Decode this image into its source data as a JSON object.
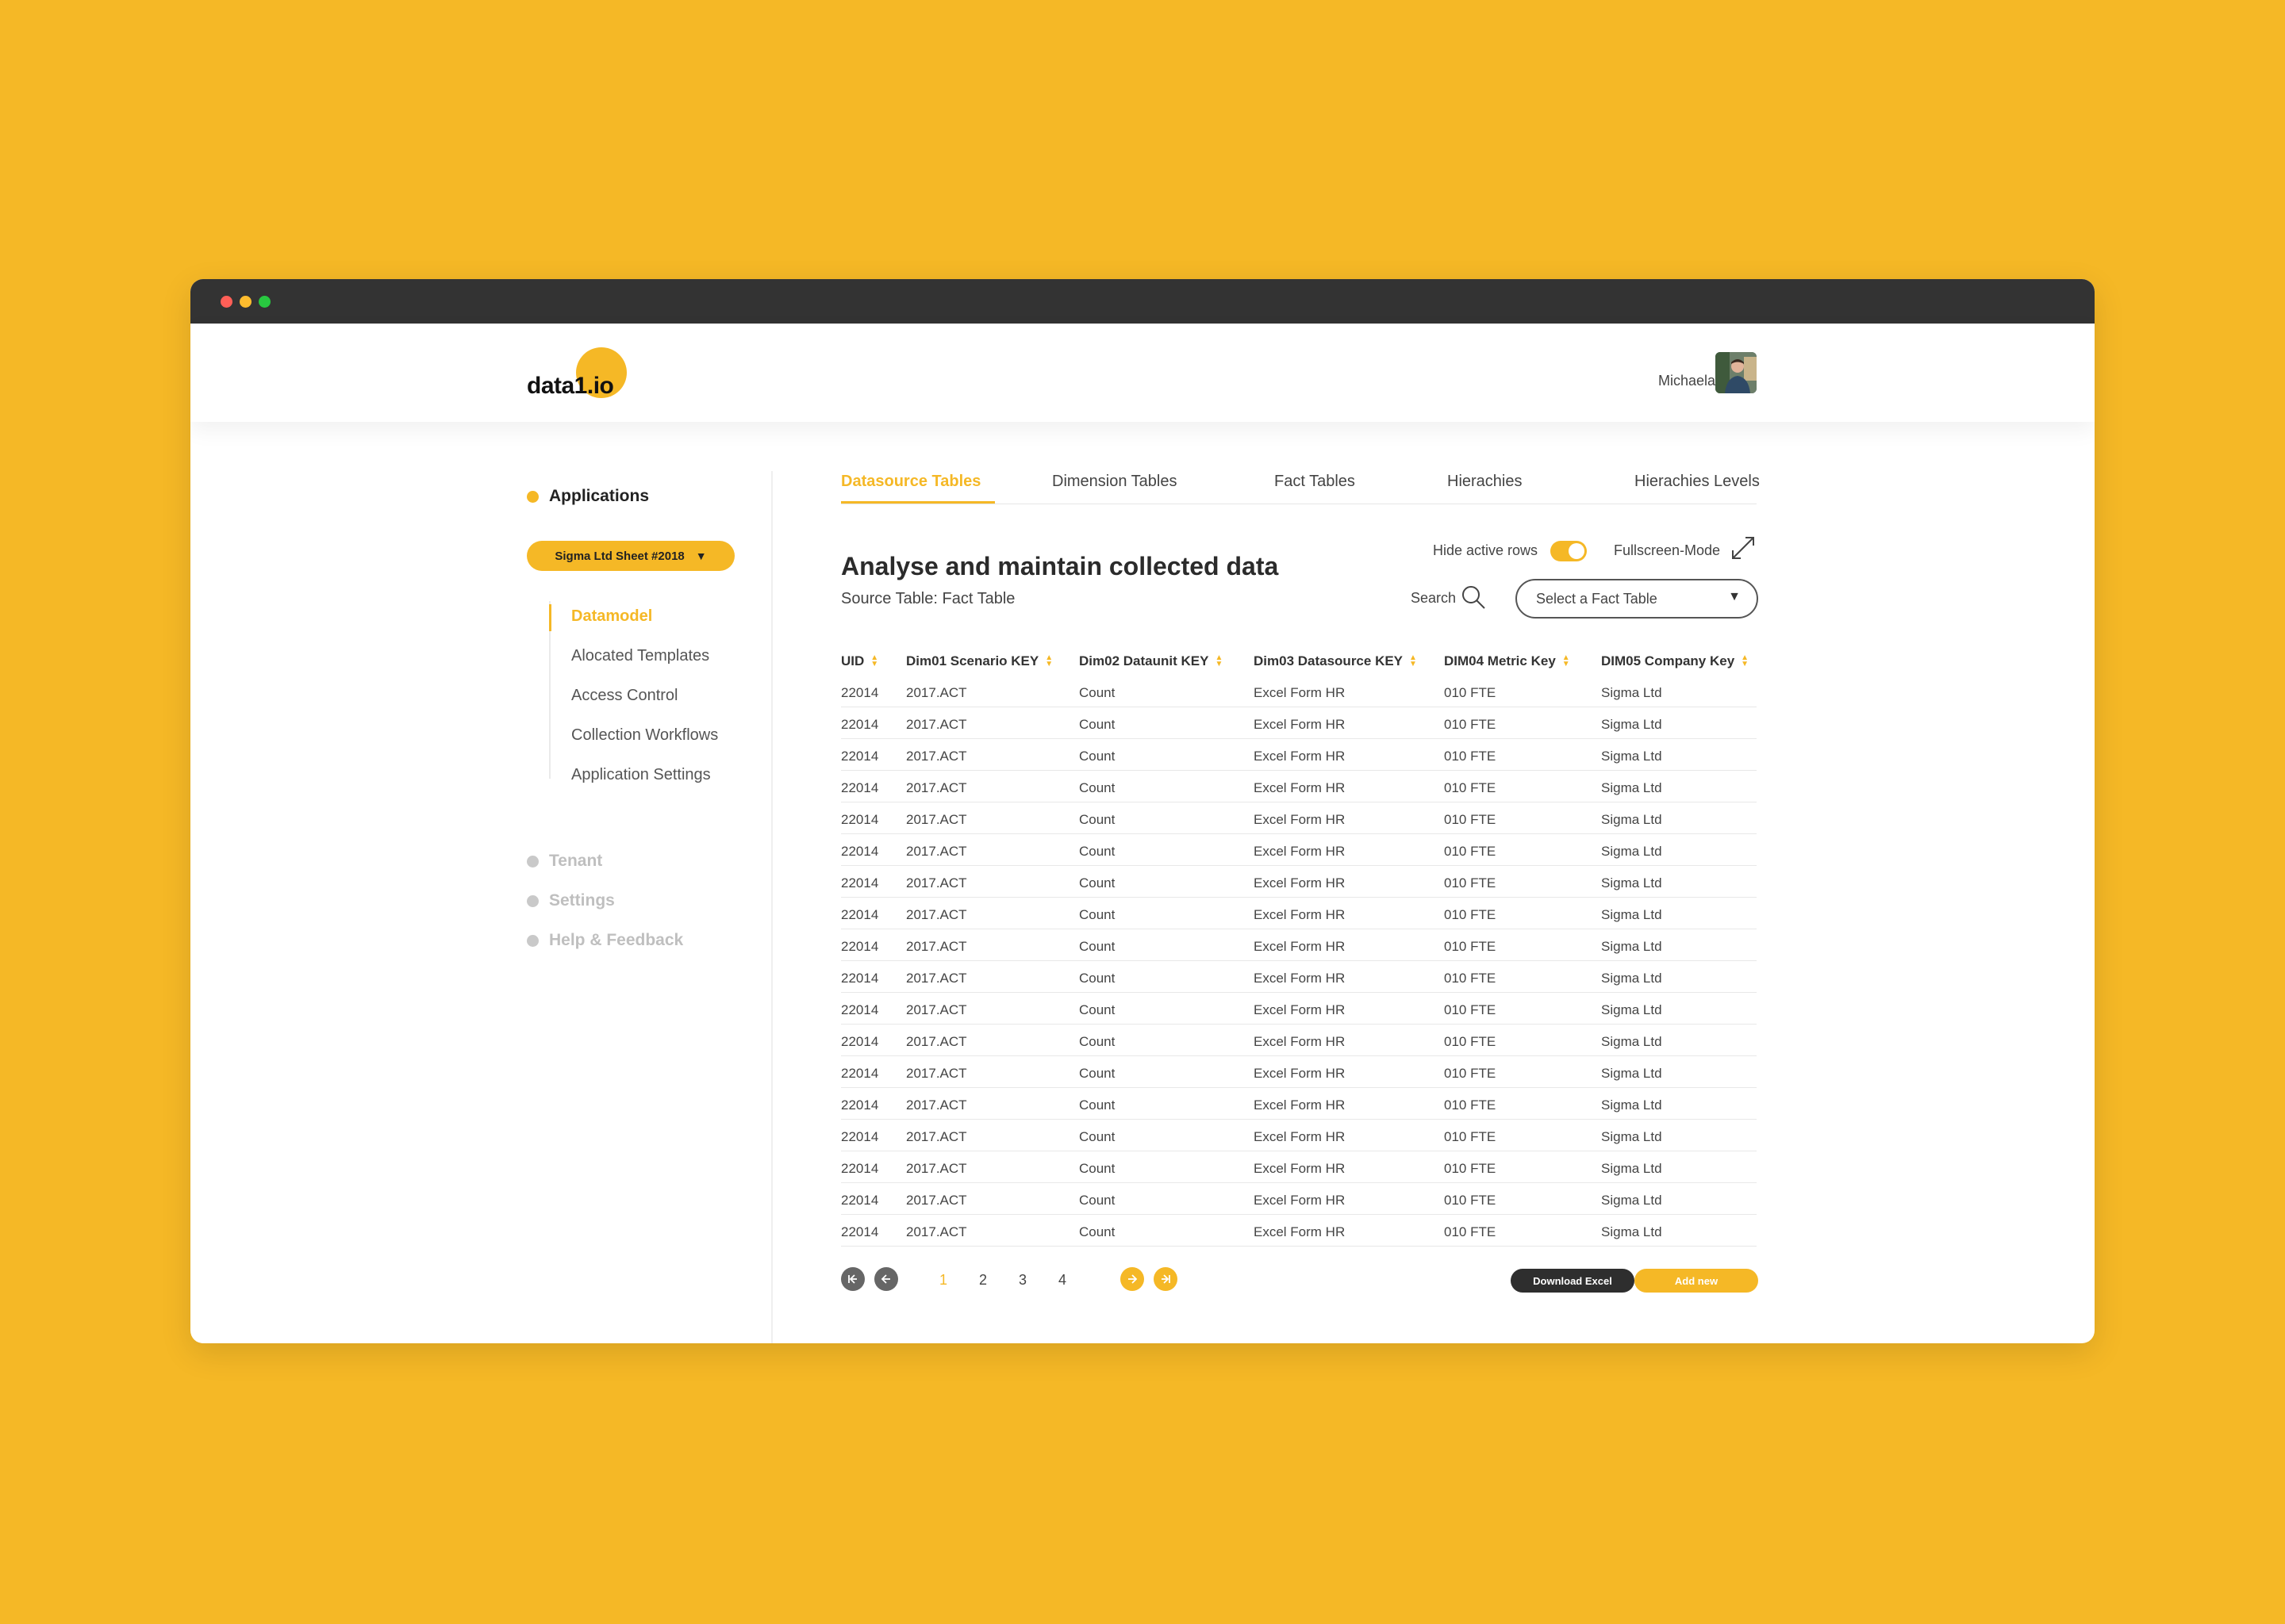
{
  "header": {
    "logo_text": "data1.io",
    "user_name": "Michaela"
  },
  "sidebar": {
    "applications_label": "Applications",
    "app_selector": "Sigma Ltd Sheet #2018",
    "sub_items": [
      {
        "label": "Datamodel",
        "active": true
      },
      {
        "label": "Alocated Templates",
        "active": false
      },
      {
        "label": "Access Control",
        "active": false
      },
      {
        "label": "Collection Workflows",
        "active": false
      },
      {
        "label": "Application Settings",
        "active": false
      }
    ],
    "other_sections": [
      "Tenant",
      "Settings",
      "Help & Feedback"
    ]
  },
  "tabs": [
    {
      "label": "Datasource Tables",
      "active": true
    },
    {
      "label": "Dimension Tables",
      "active": false
    },
    {
      "label": "Fact Tables",
      "active": false
    },
    {
      "label": "Hierachies",
      "active": false
    },
    {
      "label": "Hierachies Levels",
      "active": false
    }
  ],
  "main": {
    "title": "Analyse and maintain collected data",
    "subtitle": "Source Table: Fact Table",
    "hide_rows_label": "Hide active rows",
    "hide_rows_on": true,
    "fullscreen_label": "Fullscreen-Mode",
    "search_label": "Search",
    "fact_select_placeholder": "Select a Fact Table"
  },
  "table": {
    "columns": [
      "UID",
      "Dim01 Scenario KEY",
      "Dim02 Dataunit KEY",
      "Dim03 Datasource KEY",
      "DIM04 Metric Key",
      "DIM05 Company Key"
    ],
    "rows": [
      [
        "22014",
        "2017.ACT",
        "Count",
        "Excel Form HR",
        "010 FTE",
        "Sigma Ltd"
      ],
      [
        "22014",
        "2017.ACT",
        "Count",
        "Excel Form HR",
        "010 FTE",
        "Sigma Ltd"
      ],
      [
        "22014",
        "2017.ACT",
        "Count",
        "Excel Form HR",
        "010 FTE",
        "Sigma Ltd"
      ],
      [
        "22014",
        "2017.ACT",
        "Count",
        "Excel Form HR",
        "010 FTE",
        "Sigma Ltd"
      ],
      [
        "22014",
        "2017.ACT",
        "Count",
        "Excel Form HR",
        "010 FTE",
        "Sigma Ltd"
      ],
      [
        "22014",
        "2017.ACT",
        "Count",
        "Excel Form HR",
        "010 FTE",
        "Sigma Ltd"
      ],
      [
        "22014",
        "2017.ACT",
        "Count",
        "Excel Form HR",
        "010 FTE",
        "Sigma Ltd"
      ],
      [
        "22014",
        "2017.ACT",
        "Count",
        "Excel Form HR",
        "010 FTE",
        "Sigma Ltd"
      ],
      [
        "22014",
        "2017.ACT",
        "Count",
        "Excel Form HR",
        "010 FTE",
        "Sigma Ltd"
      ],
      [
        "22014",
        "2017.ACT",
        "Count",
        "Excel Form HR",
        "010 FTE",
        "Sigma Ltd"
      ],
      [
        "22014",
        "2017.ACT",
        "Count",
        "Excel Form HR",
        "010 FTE",
        "Sigma Ltd"
      ],
      [
        "22014",
        "2017.ACT",
        "Count",
        "Excel Form HR",
        "010 FTE",
        "Sigma Ltd"
      ],
      [
        "22014",
        "2017.ACT",
        "Count",
        "Excel Form HR",
        "010 FTE",
        "Sigma Ltd"
      ],
      [
        "22014",
        "2017.ACT",
        "Count",
        "Excel Form HR",
        "010 FTE",
        "Sigma Ltd"
      ],
      [
        "22014",
        "2017.ACT",
        "Count",
        "Excel Form HR",
        "010 FTE",
        "Sigma Ltd"
      ],
      [
        "22014",
        "2017.ACT",
        "Count",
        "Excel Form HR",
        "010 FTE",
        "Sigma Ltd"
      ],
      [
        "22014",
        "2017.ACT",
        "Count",
        "Excel Form HR",
        "010 FTE",
        "Sigma Ltd"
      ],
      [
        "22014",
        "2017.ACT",
        "Count",
        "Excel Form HR",
        "010 FTE",
        "Sigma Ltd"
      ]
    ]
  },
  "pagination": {
    "pages": [
      "1",
      "2",
      "3",
      "4"
    ],
    "current": "1"
  },
  "actions": {
    "download_label": "Download Excel",
    "add_label": "Add new"
  },
  "colors": {
    "accent": "#F5B826",
    "titlebar": "#333333",
    "dark_button": "#2e2e2e"
  }
}
